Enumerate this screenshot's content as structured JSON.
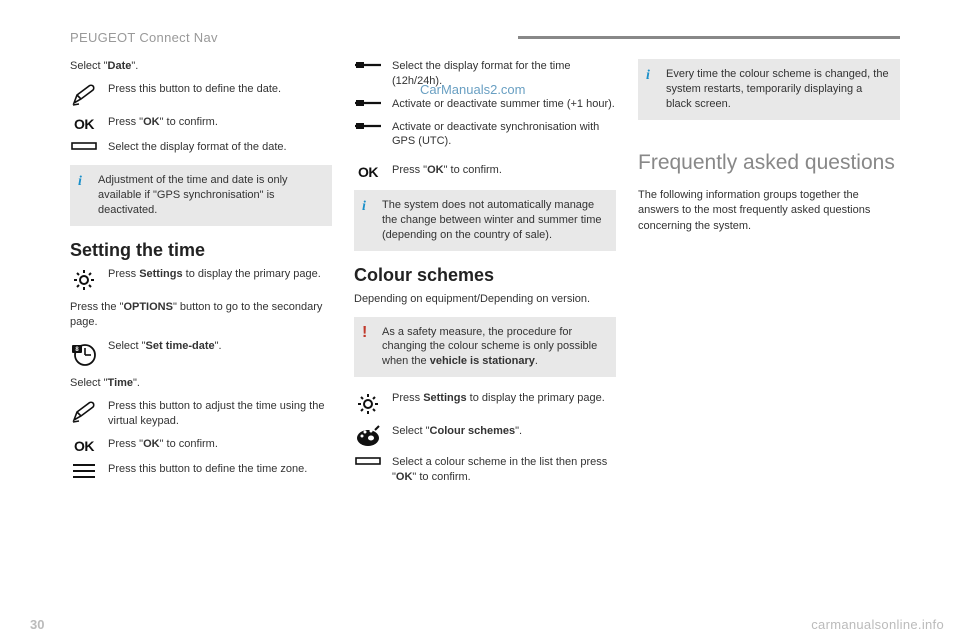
{
  "header": {
    "title": "PEUGEOT Connect Nav"
  },
  "pageNumber": "30",
  "watermarkTop": "CarManuals2.com",
  "watermarkBottom": "carmanualsonline.info",
  "col1": {
    "selectDate": {
      "pre": "Select \"",
      "bold": "Date",
      "post": "\"."
    },
    "defineDate": "Press this button to define the date.",
    "okConfirm": {
      "pre": "Press \"",
      "bold": "OK",
      "post": "\" to confirm."
    },
    "displayFormatDate": "Select the display format of the date.",
    "infoGps": "Adjustment of the time and date is only available if \"GPS synchronisation\" is deactivated.",
    "settingTimeHeading": "Setting the time",
    "pressSettings": {
      "pre": "Press ",
      "bold": "Settings",
      "post": " to display the primary page."
    },
    "pressOptions": {
      "pre": "Press the \"",
      "bold": "OPTIONS",
      "post": "\" button to go to the secondary page."
    },
    "selectSetTimeDate": {
      "pre": "Select \"",
      "bold": "Set time-date",
      "post": "\"."
    },
    "selectTime": {
      "pre": "Select \"",
      "bold": "Time",
      "post": "\"."
    },
    "adjustTime": "Press this button to adjust the time using the virtual keypad.",
    "okConfirm2": {
      "pre": "Press \"",
      "bold": "OK",
      "post": "\" to confirm."
    },
    "defineTimezone": "Press this button to define the time zone."
  },
  "col2": {
    "displayFormatTime": "Select the display format for the time (12h/24h).",
    "summerTime": "Activate or deactivate summer time (+1 hour).",
    "gpsSync": "Activate or deactivate synchronisation with GPS (UTC).",
    "okConfirm": {
      "pre": "Press \"",
      "bold": "OK",
      "post": "\" to confirm."
    },
    "infoAuto": "The system does not automatically manage the change between winter and summer time (depending on the country of sale).",
    "colourSchemesHeading": "Colour schemes",
    "dependingOn": "Depending on equipment/Depending on version.",
    "safetyWarn": {
      "pre": "As a safety measure, the procedure for changing the colour scheme is only possible when the ",
      "bold": "vehicle is stationary",
      "post": "."
    },
    "pressSettings": {
      "pre": "Press ",
      "bold": "Settings",
      "post": " to display the primary page."
    },
    "selectColourSchemes": {
      "pre": "Select \"",
      "bold": "Colour schemes",
      "post": "\"."
    },
    "selectScheme": {
      "pre": "Select a colour scheme in the list then press \"",
      "bold": "OK",
      "post": "\" to confirm."
    }
  },
  "col3": {
    "infoRestart": "Every time the colour scheme is changed, the system restarts, temporarily displaying a black screen.",
    "faqHeading": "Frequently asked questions",
    "faqBody": "The following information groups together the answers to the most frequently asked questions concerning the system."
  }
}
